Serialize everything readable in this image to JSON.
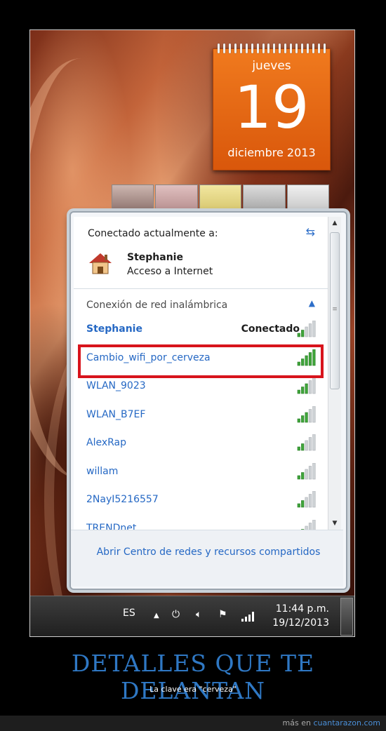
{
  "calendar": {
    "weekday": "jueves",
    "day": "19",
    "month_year": "diciembre 2013"
  },
  "network_popup": {
    "header": "Conectado actualmente a:",
    "current": {
      "name": "Stephanie",
      "status": "Acceso a Internet"
    },
    "section_title": "Conexión de red inalámbrica",
    "networks": [
      {
        "name": "Stephanie",
        "status": "Conectado",
        "signal": 0.4
      },
      {
        "name": "Cambio_wifi_por_cerveza",
        "status": "",
        "signal": 1.0
      },
      {
        "name": "WLAN_9023",
        "status": "",
        "signal": 0.6
      },
      {
        "name": "WLAN_B7EF",
        "status": "",
        "signal": 0.6
      },
      {
        "name": "AlexRap",
        "status": "",
        "signal": 0.4
      },
      {
        "name": "willam",
        "status": "",
        "signal": 0.4
      },
      {
        "name": "2NayI5216557",
        "status": "",
        "signal": 0.4
      },
      {
        "name": "TRENDnet",
        "status": "",
        "signal": 0.4
      }
    ],
    "footer_link": "Abrir Centro de redes y recursos compartidos"
  },
  "taskbar": {
    "language": "ES",
    "time": "11:44 p.m.",
    "date": "19/12/2013"
  },
  "caption": {
    "title": "DETALLES QUE TE DELANTAN",
    "subtitle": "La clave era \"cerveza\"",
    "credit_prefix": "más en",
    "credit_link": "cuantarazon.com"
  },
  "colors": {
    "accent": "#2568c4",
    "highlight": "#d8141c",
    "calendar": "#e8660f"
  },
  "icons": [
    "refresh-icon",
    "house-icon",
    "chevron-up-icon",
    "signal-bars-icon",
    "flag-icon",
    "speaker-icon",
    "power-icon"
  ]
}
